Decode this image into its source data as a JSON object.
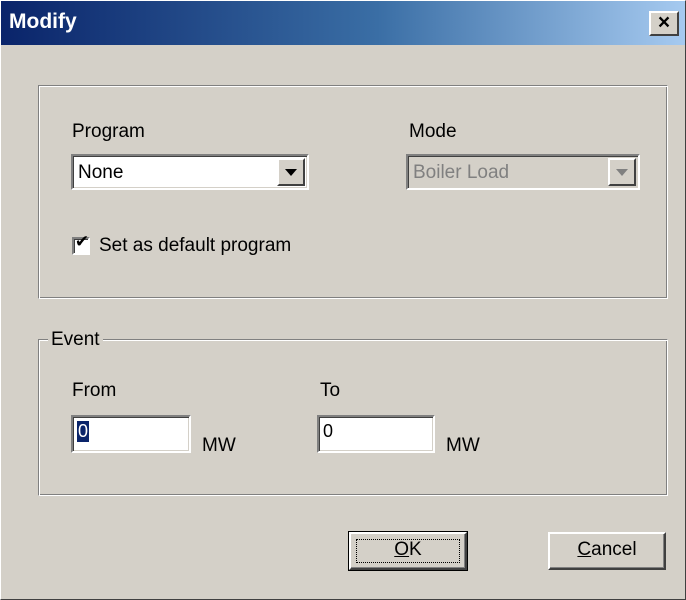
{
  "window": {
    "title": "Modify",
    "close_symbol": "×"
  },
  "program": {
    "label": "Program",
    "selected": "None"
  },
  "mode": {
    "label": "Mode",
    "selected": "Boiler Load",
    "disabled": true
  },
  "default_checkbox": {
    "label": "Set as default program",
    "checked": true,
    "mark": "✔"
  },
  "event": {
    "legend": "Event",
    "from_label": "From",
    "from_value": "0",
    "from_unit": "MW",
    "to_label": "To",
    "to_value": "0",
    "to_unit": "MW"
  },
  "buttons": {
    "ok_mnemonic": "O",
    "ok_rest": "K",
    "cancel_mnemonic": "C",
    "cancel_rest": "ancel"
  },
  "colors": {
    "title_gradient_start": "#0a246a",
    "title_gradient_end": "#a6caf0",
    "dialog_face": "#d4d0c8",
    "selection": "#0a246a"
  }
}
